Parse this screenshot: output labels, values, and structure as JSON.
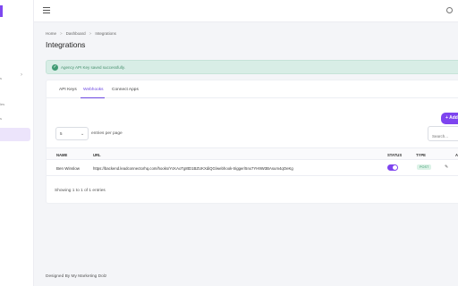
{
  "sidebar": {
    "fragments": [
      {
        "text": "s"
      },
      {
        "text": "les"
      },
      {
        "text": "s"
      }
    ],
    "chevron_icon": "chevron-right-icon"
  },
  "topbar": {
    "menu_icon": "hamburger-icon",
    "user_icon": "user-icon"
  },
  "breadcrumb": {
    "items": [
      "Home",
      "Dashboard",
      "Integrations"
    ],
    "separator": ">"
  },
  "page": {
    "title": "Integrations"
  },
  "alert": {
    "text": "Agency API Key saved successfully.",
    "icon": "check-circle-icon",
    "icon_glyph": "✓",
    "color": "#d8ede6"
  },
  "tabs": [
    {
      "label": "API Keys",
      "active": false
    },
    {
      "label": "Webhooks",
      "active": true
    },
    {
      "label": "Connect Apps",
      "active": false
    }
  ],
  "toolbar": {
    "add_label": "+ Add",
    "entries_value": "5",
    "entries_label": "entries per page",
    "search_placeholder": "Search..."
  },
  "table": {
    "headers": {
      "name": "NAME",
      "url": "URL",
      "status": "STATUS",
      "type": "TYPE",
      "actions": "A"
    },
    "rows": [
      {
        "name": "Ben Winslow",
        "url": "https://backend.leadconnectorhq.com/hooks/YcKAoTg8tD1BZUKXdiQG/webhook-trigger/5nx7YH9W3BAsum4qOeKg",
        "status": true,
        "type": "POST"
      }
    ],
    "summary": "Showing 1 to 1 of 1 entries"
  },
  "footer": {
    "text": "Designed By My Marketing Dolz"
  },
  "colors": {
    "accent": "#7e44ef",
    "success": "#3e9a72"
  }
}
